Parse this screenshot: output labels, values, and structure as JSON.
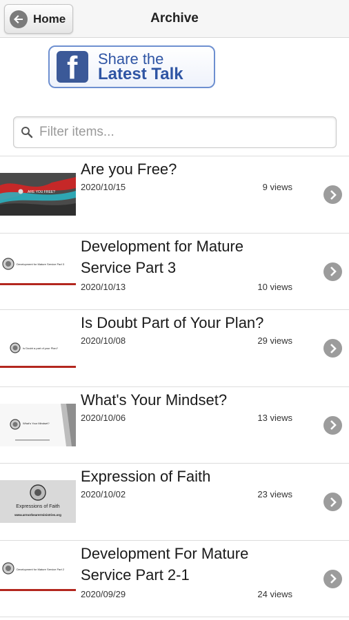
{
  "header": {
    "title": "Archive",
    "home_label": "Home"
  },
  "share": {
    "line1": "Share the",
    "line2": "Latest Talk"
  },
  "search": {
    "placeholder": "Filter items..."
  },
  "items": [
    {
      "title": "Are you Free?",
      "date": "2020/10/15",
      "views": "9 views",
      "thumb_text": "ARE YOU FREE?"
    },
    {
      "title": "Development for Mature Service Part 3",
      "date": "2020/10/13",
      "views": "10 views",
      "thumb_text": "Development for Mature Service Part 3"
    },
    {
      "title": "Is Doubt Part of Your Plan?",
      "date": "2020/10/08",
      "views": "29 views",
      "thumb_text": "Is Doubt a part of your Plan?"
    },
    {
      "title": "What's Your Mindset?",
      "date": "2020/10/06",
      "views": "13 views",
      "thumb_text": "What's Your Mindset?"
    },
    {
      "title": "Expression of Faith",
      "date": "2020/10/02",
      "views": "23 views",
      "thumb_text": "Expressions of Faith",
      "thumb_url": "www.armorbearerministries.org"
    },
    {
      "title": "Development For Mature Service Part 2-1",
      "date": "2020/09/29",
      "views": "24 views",
      "thumb_text": "Development for Mature Service Part 2"
    }
  ],
  "colors": {
    "facebook": "#3b5998",
    "accent_red": "#b3261e"
  }
}
